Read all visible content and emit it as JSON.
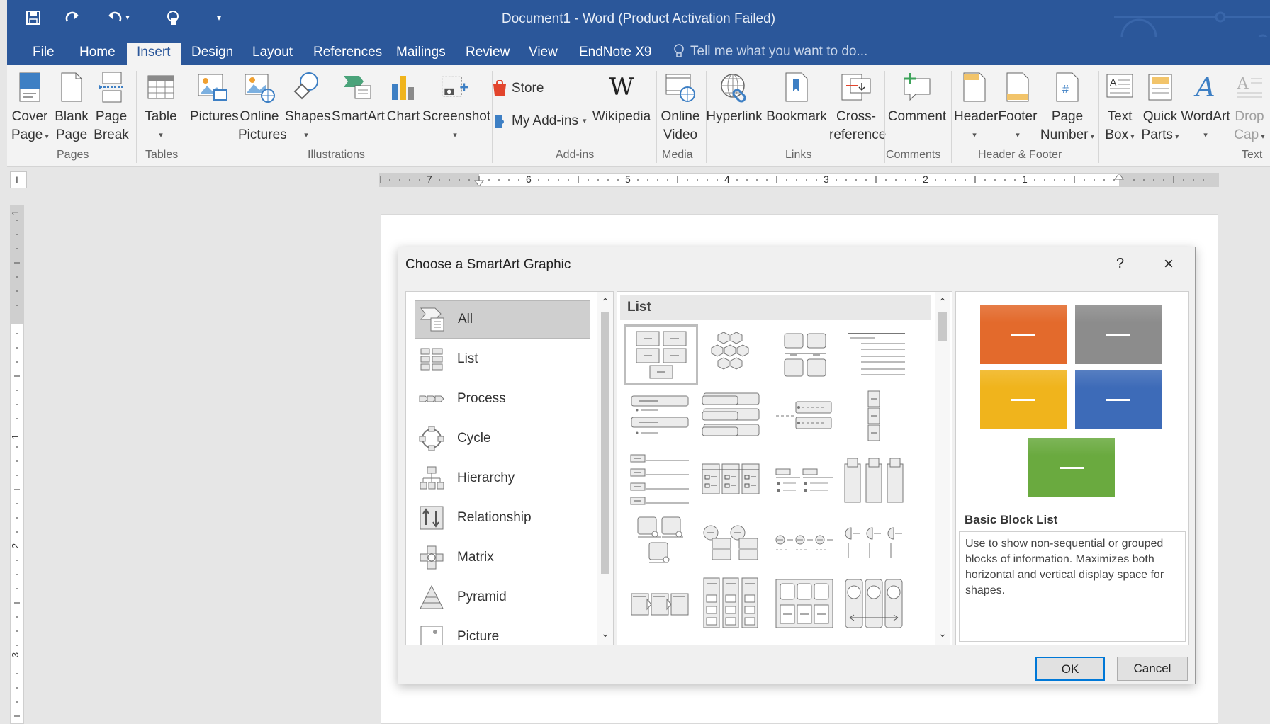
{
  "window": {
    "title": "Document1 - Word (Product Activation Failed)"
  },
  "tabs": [
    "File",
    "Home",
    "Insert",
    "Design",
    "Layout",
    "References",
    "Mailings",
    "Review",
    "View",
    "EndNote X9"
  ],
  "tell_me": "Tell me what you want to do...",
  "ribbon": {
    "cover_page": [
      "Cover",
      "Page"
    ],
    "blank_page": [
      "Blank",
      "Page"
    ],
    "page_break": [
      "Page",
      "Break"
    ],
    "table": "Table",
    "pictures": "Pictures",
    "online_pictures": [
      "Online",
      "Pictures"
    ],
    "shapes": "Shapes",
    "smartart": "SmartArt",
    "chart": "Chart",
    "screenshot": "Screenshot",
    "store": "Store",
    "my_addins": "My Add-ins",
    "wikipedia": "Wikipedia",
    "online_video": [
      "Online",
      "Video"
    ],
    "hyperlink": "Hyperlink",
    "bookmark": "Bookmark",
    "cross_reference": [
      "Cross-",
      "reference"
    ],
    "comment": "Comment",
    "header": "Header",
    "footer": "Footer",
    "page_number": [
      "Page",
      "Number"
    ],
    "text_box": [
      "Text",
      "Box"
    ],
    "quick_parts": [
      "Quick",
      "Parts"
    ],
    "wordart": "WordArt",
    "drop_cap": [
      "Drop",
      "Cap"
    ],
    "groups": [
      "Pages",
      "Tables",
      "Illustrations",
      "Add-ins",
      "Media",
      "Links",
      "Comments",
      "Header & Footer",
      "Text"
    ]
  },
  "ruler": {
    "tab_selector": "L",
    "h_labels": [
      "7",
      "6",
      "5",
      "4",
      "3",
      "2",
      "1"
    ],
    "v_labels": [
      "1",
      "1",
      "2",
      "3"
    ]
  },
  "dialog": {
    "title": "Choose a SmartArt Graphic",
    "help": "?",
    "close": "×",
    "categories": [
      "All",
      "List",
      "Process",
      "Cycle",
      "Hierarchy",
      "Relationship",
      "Matrix",
      "Pyramid",
      "Picture"
    ],
    "selected_category": "All",
    "section_header": "List",
    "preview_colors": [
      "#e36a2c",
      "#8c8c8c",
      "#f0b41c",
      "#3d6bb8",
      "#6aaa3f"
    ],
    "preview_title": "Basic Block List",
    "preview_description": "Use to show non-sequential or grouped blocks of information. Maximizes both horizontal and vertical display space for shapes.",
    "ok": "OK",
    "cancel": "Cancel"
  }
}
